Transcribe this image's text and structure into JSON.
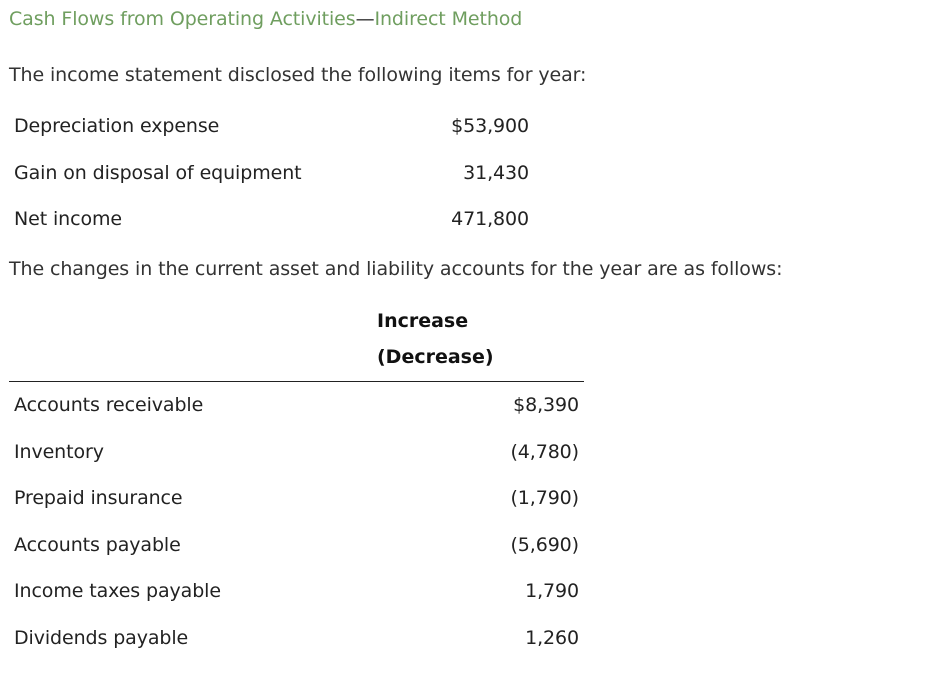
{
  "title": {
    "part1": "Cash Flows from Operating Activities",
    "dash": "—",
    "part2": "Indirect Method"
  },
  "intro_text": "The income statement disclosed the following items for year:",
  "income_items": [
    {
      "label": "Depreciation expense",
      "value": "$53,900"
    },
    {
      "label": "Gain on disposal of equipment",
      "value": "31,430"
    },
    {
      "label": "Net income",
      "value": "471,800"
    }
  ],
  "changes_text": "The changes in the current asset and liability accounts for the year are as follows:",
  "changes_table": {
    "header_line1": "Increase",
    "header_line2": "(Decrease)",
    "rows": [
      {
        "label": "Accounts receivable",
        "value": "$8,390"
      },
      {
        "label": "Inventory",
        "value": "(4,780)"
      },
      {
        "label": "Prepaid insurance",
        "value": "(1,790)"
      },
      {
        "label": "Accounts payable",
        "value": "(5,690)"
      },
      {
        "label": "Income taxes payable",
        "value": "1,790"
      },
      {
        "label": "Dividends payable",
        "value": "1,260"
      }
    ]
  },
  "colors": {
    "title": "#6f9e5f",
    "text": "#222222"
  }
}
